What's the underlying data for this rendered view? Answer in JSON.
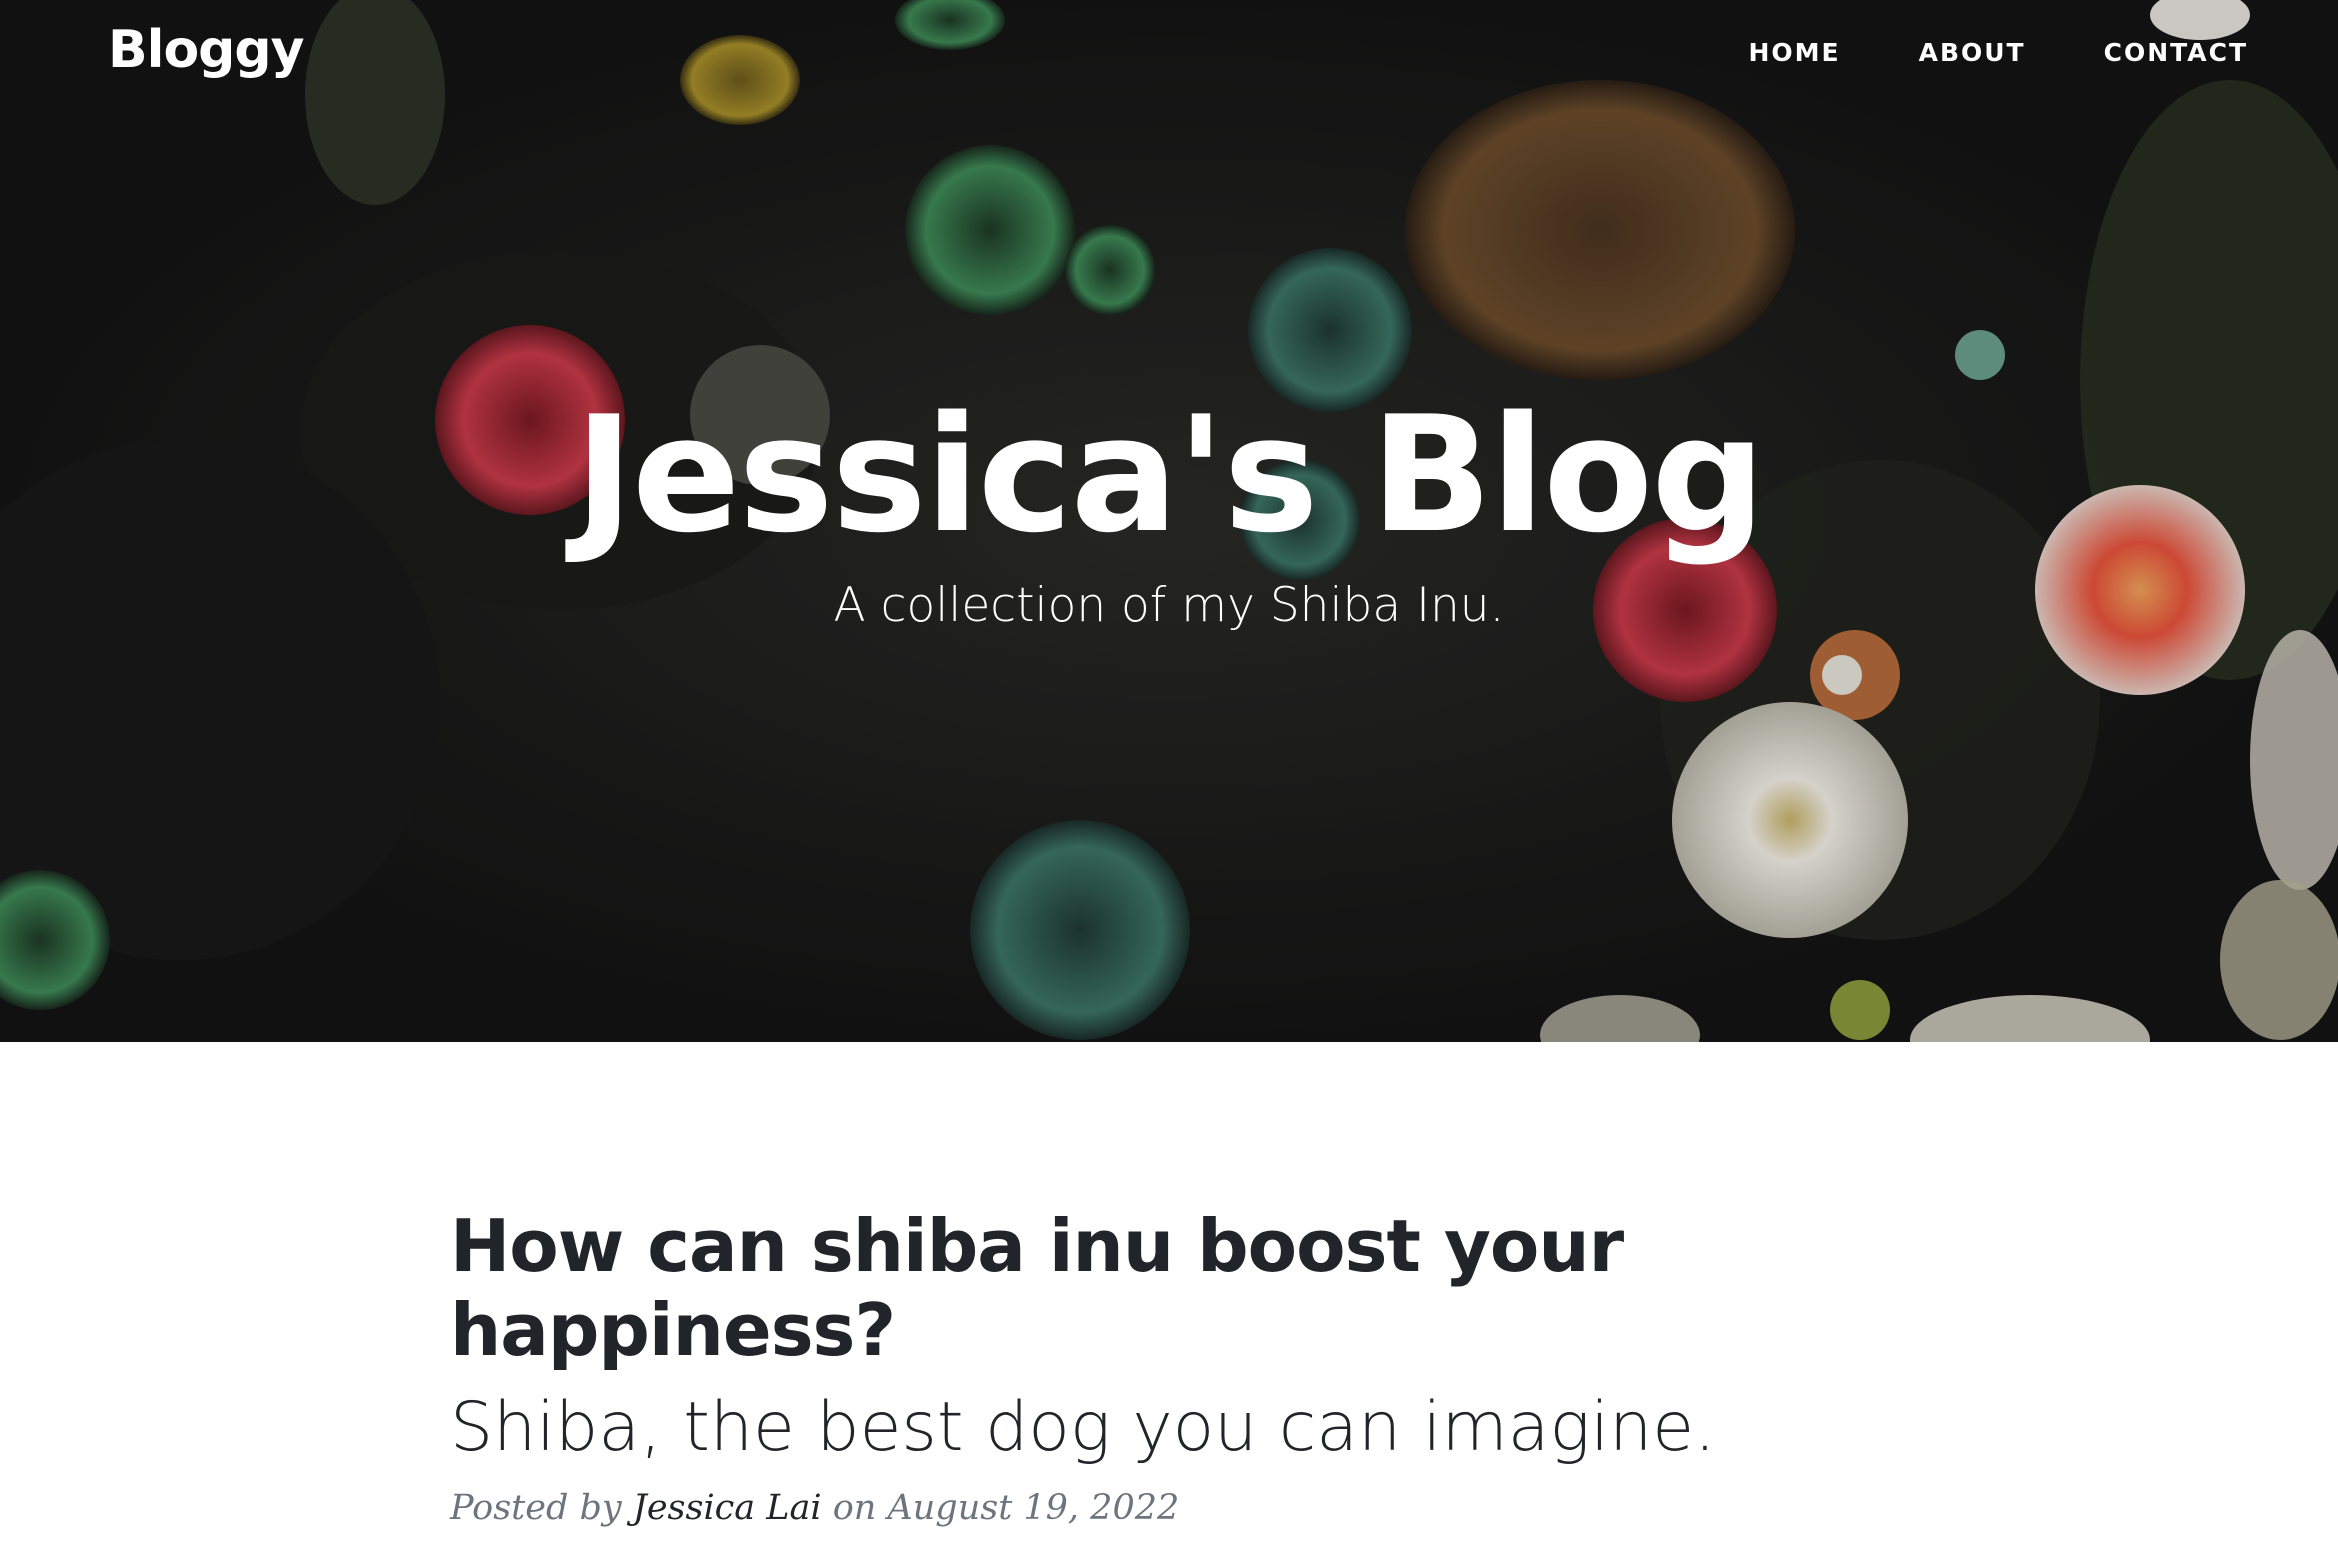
{
  "navbar": {
    "brand": "Bloggy",
    "links": [
      {
        "label": "HOME"
      },
      {
        "label": "ABOUT"
      },
      {
        "label": "CONTACT"
      }
    ]
  },
  "hero": {
    "title": "Jessica's Blog",
    "subtitle": "A collection of my Shiba Inu."
  },
  "posts": [
    {
      "title": "How can shiba inu boost your happiness?",
      "subtitle": "Shiba, the best dog you can imagine.",
      "meta_prefix": "Posted by",
      "author": "Jessica Lai",
      "meta_on": "on",
      "date": "August 19, 2022"
    }
  ],
  "colors": {
    "hero_background": "#161616",
    "text_dark": "#212529",
    "meta_gray": "#6c757d",
    "white": "#ffffff"
  }
}
